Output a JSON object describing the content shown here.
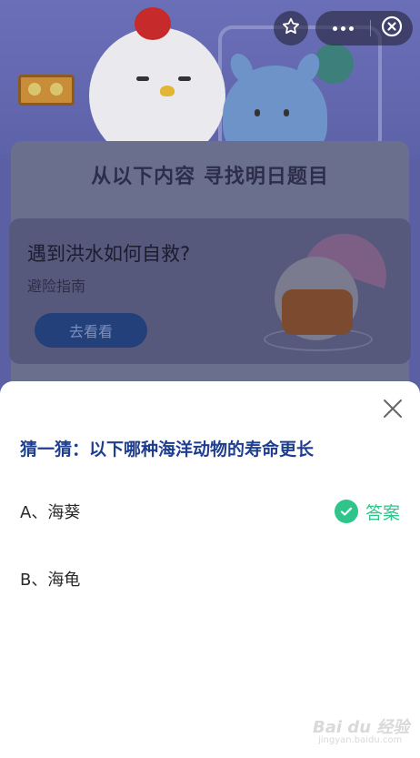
{
  "background": {
    "find_title": "从以下内容  寻找明日题目",
    "card_title": "遇到洪水如何自救?",
    "card_subtitle": "避险指南",
    "card_button": "去看看"
  },
  "topbar": {
    "favorite_icon": "star-icon",
    "more_icon": "more-dots-icon",
    "close_icon": "close-circle-icon"
  },
  "sheet": {
    "question": "猜一猜：以下哪种海洋动物的寿命更长",
    "options": [
      {
        "label": "A、海葵",
        "is_answer": true
      },
      {
        "label": "B、海龟",
        "is_answer": false
      }
    ],
    "answer_label": "答案",
    "close_icon": "close-icon"
  },
  "watermark": {
    "text": "Bai du 经验",
    "sub": "jingyan.baidu.com"
  },
  "colors": {
    "accent_green": "#2fc489",
    "question_blue": "#1f3f8e"
  }
}
